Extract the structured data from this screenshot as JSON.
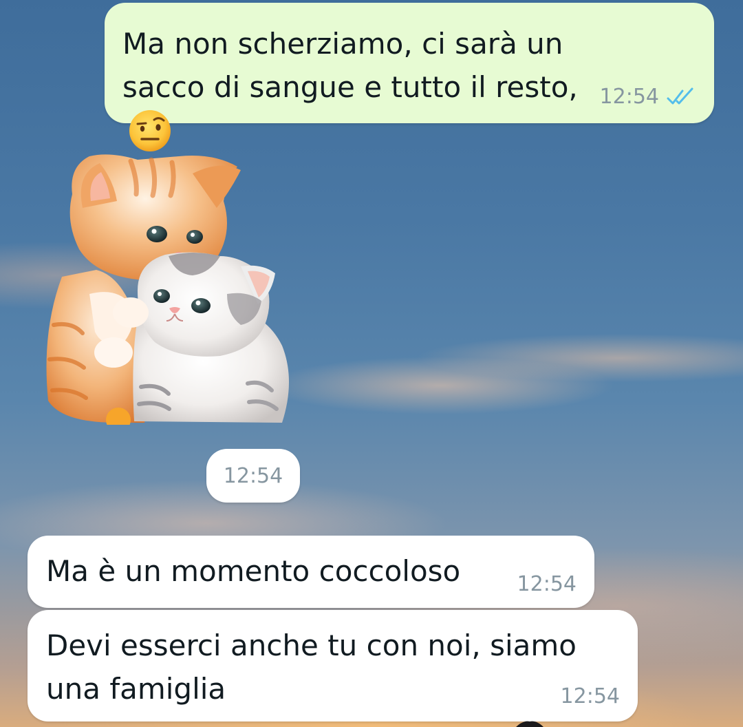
{
  "chat": {
    "messages": [
      {
        "direction": "outgoing",
        "text": "Ma non scherziamo, ci sarà un sacco di sangue e tutto il resto,",
        "emoji": "face-with-raised-eyebrow",
        "time": "12:54",
        "status": "read",
        "status_icon": "double-check-icon",
        "status_color": "#53bdeb"
      },
      {
        "direction": "incoming",
        "type": "sticker",
        "sticker": "two-kittens-hugging-sticker",
        "time": "12:54"
      },
      {
        "direction": "incoming",
        "text": "Ma è un momento coccoloso",
        "time": "12:54"
      },
      {
        "direction": "incoming",
        "text": "Devi esserci anche tu con noi, siamo una famiglia",
        "time": "12:54"
      }
    ]
  },
  "colors": {
    "outgoing_bubble": "#e7fbd3",
    "incoming_bubble": "#ffffff",
    "meta_text": "#8696a0",
    "read_ticks": "#53bdeb"
  }
}
